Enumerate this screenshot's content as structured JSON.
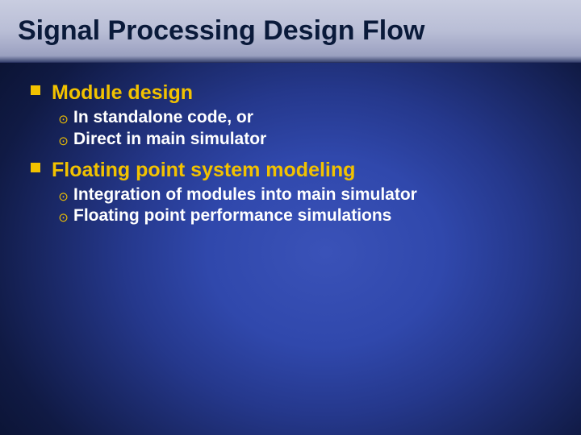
{
  "title": "Signal Processing Design Flow",
  "items": [
    {
      "label": "Module design",
      "sub": [
        "In standalone code, or",
        "Direct in main simulator"
      ]
    },
    {
      "label": "Floating point system modeling",
      "sub": [
        "Integration of modules into main simulator",
        "Floating point performance simulations"
      ]
    }
  ]
}
